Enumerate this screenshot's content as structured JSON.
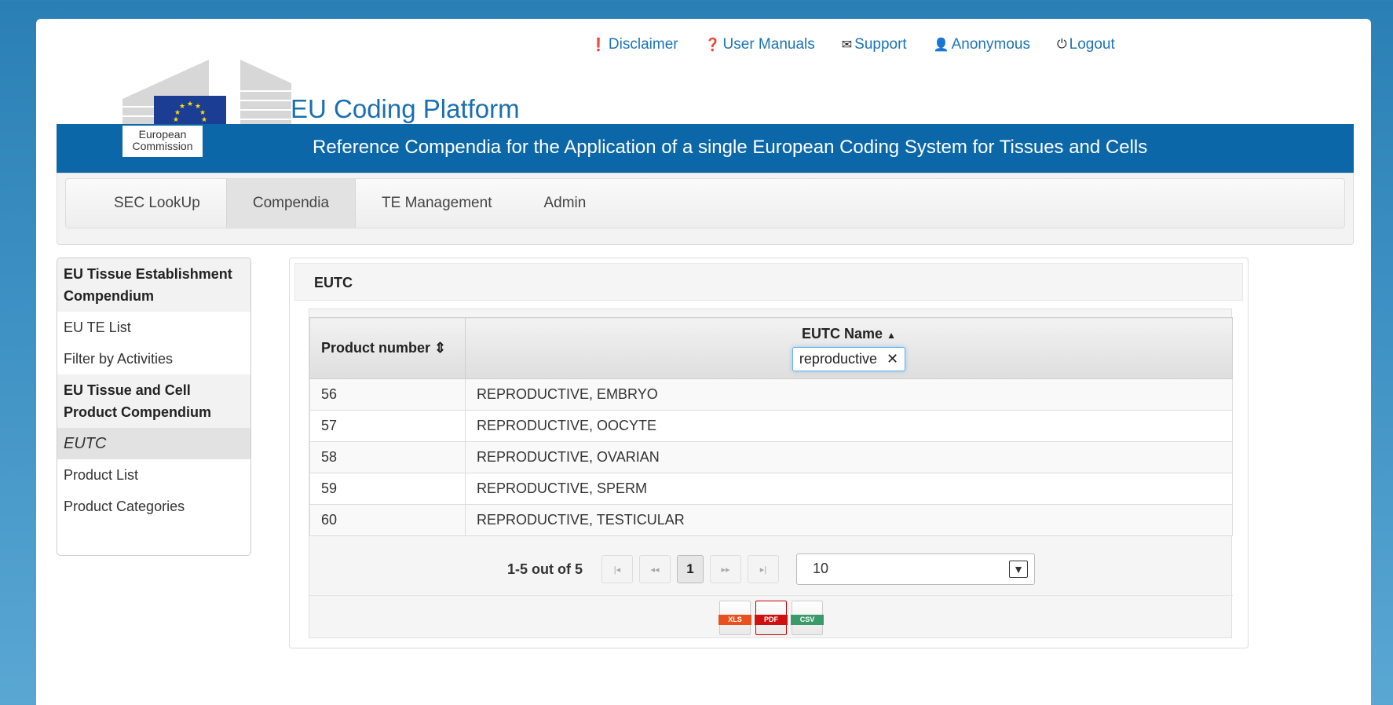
{
  "header": {
    "org_line1": "European",
    "org_line2": "Commission",
    "app_title": "EU Coding Platform",
    "banner": "Reference Compendia for the Application of a single European Coding System for Tissues and Cells",
    "links": [
      {
        "label": "Disclaimer",
        "icon": "exclamation-circle-icon"
      },
      {
        "label": "User Manuals",
        "icon": "question-circle-icon"
      },
      {
        "label": " Support",
        "icon": "envelope-icon"
      },
      {
        "label": "Anonymous",
        "icon": "user-icon"
      },
      {
        "label": " Logout",
        "icon": "power-icon"
      }
    ]
  },
  "nav": {
    "items": [
      "SEC LookUp",
      "Compendia",
      "TE Management",
      "Admin"
    ],
    "active": "Compendia"
  },
  "sidebar": {
    "group1": "EU Tissue Establishment Compendium",
    "items1": [
      "EU TE List",
      "Filter by Activities"
    ],
    "group2": "EU Tissue and Cell Product Compendium",
    "items2": [
      "EUTC",
      "Product List",
      "Product Categories"
    ],
    "active": "EUTC"
  },
  "panel": {
    "title": "EUTC",
    "columns": {
      "product_number": "Product number",
      "eutc_name": "EUTC Name"
    },
    "filter_value": "reproductive",
    "rows": [
      {
        "num": "56",
        "name": "REPRODUCTIVE, EMBRYO"
      },
      {
        "num": "57",
        "name": "REPRODUCTIVE, OOCYTE"
      },
      {
        "num": "58",
        "name": "REPRODUCTIVE, OVARIAN"
      },
      {
        "num": "59",
        "name": "REPRODUCTIVE, SPERM"
      },
      {
        "num": "60",
        "name": "REPRODUCTIVE, TESTICULAR"
      }
    ],
    "pager": {
      "count": "1-5 out of 5",
      "current_page": "1",
      "page_size": "10"
    },
    "exports": [
      "XLS",
      "PDF",
      "CSV"
    ]
  },
  "colors": {
    "accent": "#1b74b6",
    "banner": "#0b67a8"
  }
}
